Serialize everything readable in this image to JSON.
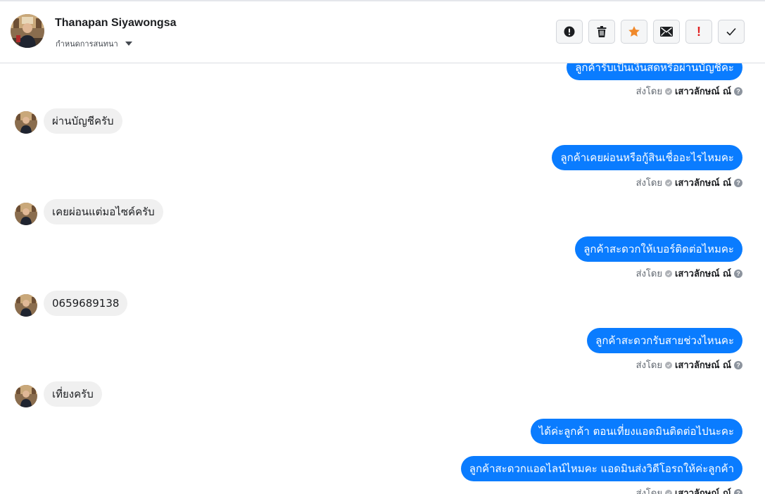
{
  "header": {
    "contact_name": "Thanapan Siyawongsa",
    "assign_label": "กำหนดการสนทนา",
    "actions": [
      {
        "icon": "alert-circle-icon"
      },
      {
        "icon": "trash-icon"
      },
      {
        "icon": "star-icon"
      },
      {
        "icon": "envelope-icon"
      },
      {
        "icon": "exclamation-icon",
        "label": "!"
      },
      {
        "icon": "checkmark-icon"
      }
    ]
  },
  "colors": {
    "outgoing_bubble": "#0a7cff",
    "incoming_bubble": "#f0f0f0",
    "star": "#f0892b",
    "exclamation": "#e02020"
  },
  "sent_by_label": "ส่งโดย",
  "agent_name": "เสาวลักษณ์ ณ์",
  "messages": [
    {
      "direction": "out",
      "text": "ลูกค้ารับเป็นเงินสดหรือผ่านบัญชีคะ",
      "sent_by": true
    },
    {
      "direction": "in",
      "text": "ผ่านบัญชีครับ"
    },
    {
      "direction": "out",
      "text": "ลูกค้าเคยผ่อนหรือกู้สินเชื่ออะไรไหมคะ",
      "sent_by": true
    },
    {
      "direction": "in",
      "text": "เคยผ่อนแต่มอไซค์ครับ"
    },
    {
      "direction": "out",
      "text": "ลูกค้าสะดวกให้เบอร์ติดต่อไหมคะ",
      "sent_by": true
    },
    {
      "direction": "in",
      "text": "0659689138"
    },
    {
      "direction": "out",
      "text": "ลูกค้าสะดวกรับสายช่วงไหนคะ",
      "sent_by": true
    },
    {
      "direction": "in",
      "text": "เที่ยงครับ"
    },
    {
      "direction": "out",
      "text": "ได้ค่ะลูกค้า ตอนเที่ยงแอดมินติดต่อไปนะคะ"
    },
    {
      "direction": "out",
      "text": "ลูกค้าสะดวกแอดไลน์ไหมคะ แอดมินส่งวิดีโอรถให้ค่ะลูกค้า",
      "sent_by": true
    }
  ]
}
